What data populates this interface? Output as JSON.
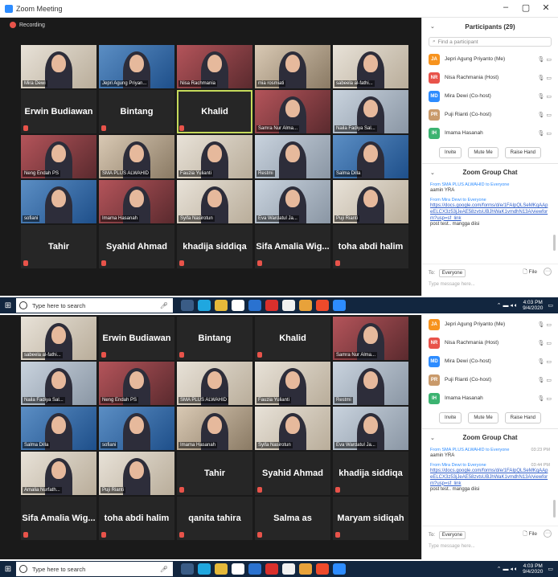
{
  "window": {
    "title": "Zoom Meeting",
    "minimize": "–",
    "maximize": "▢",
    "close": "✕"
  },
  "recording_label": "Recording",
  "participants_panel": {
    "title": "Participants (29)",
    "find_placeholder": "Find a participant",
    "invite": "Invite",
    "mute_me": "Mute Me",
    "raise_hand": "Raise Hand",
    "participants": [
      {
        "initial": "JA",
        "name": "Jepri Agung Priyanto (Me)",
        "color": "#f7931e"
      },
      {
        "initial": "NR",
        "name": "Nisa Rachmania (Host)",
        "color": "#e8534a"
      },
      {
        "initial": "MD",
        "name": "Mira Dewi (Co-host)",
        "color": "#2d8cff"
      },
      {
        "initial": "PR",
        "name": "Puji Rianti (Co-host)",
        "color": "#c99a6b"
      },
      {
        "initial": "IH",
        "name": "Imama Hasanah",
        "color": "#3cb371"
      }
    ]
  },
  "chat": {
    "title": "Zoom Group Chat",
    "msg1_from": "From SMA PLUS ALWAHID to Everyone",
    "msg1_text": "aamin YRA",
    "msg2_from": "From Mira Dewi to Everyone",
    "msg2_link": "https://docs.google.com/forms/d/e/1FAIpQLSeMKqAApeELCX3z53jJeAE58zvtsUBJhWaK1vmdhN13A/viewform?usp=sf_link",
    "msg2_text": "post test.. mangga diisi",
    "to_label": "To:",
    "to_value": "Everyone",
    "file_label": "File",
    "type_placeholder": "Type message here..."
  },
  "chat_bottom": {
    "time1": "03:23 PM",
    "time2": "03:44 PM"
  },
  "taskbar": {
    "search_placeholder": "Type here to search",
    "time": "4:03 PM",
    "date": "9/4/2020"
  },
  "top_tiles": [
    {
      "label": "Mira Dewi",
      "big": "",
      "kind": "cam",
      "bg": "bg4"
    },
    {
      "label": "Jepri Agung Priyan...",
      "big": "",
      "kind": "cam",
      "bg": "bg3"
    },
    {
      "label": "Nisa Rachmania",
      "big": "",
      "kind": "cam",
      "bg": "bg5"
    },
    {
      "label": "mia rosmiati",
      "big": "",
      "kind": "cam",
      "bg": "bg2"
    },
    {
      "label": "sabeela al-fathi...",
      "big": "",
      "kind": "cam",
      "bg": "bg4"
    },
    {
      "label": "",
      "big": "Erwin Budiawan",
      "kind": "name"
    },
    {
      "label": "",
      "big": "Bintang",
      "kind": "name"
    },
    {
      "label": "",
      "big": "Khalid",
      "kind": "name",
      "highlight": true
    },
    {
      "label": "Samra Nur Alma...",
      "big": "",
      "kind": "cam",
      "bg": "bg5"
    },
    {
      "label": "Naila Fadiya Sal...",
      "big": "",
      "kind": "cam",
      "bg": "bg1"
    },
    {
      "label": "Neng Endah PS",
      "big": "",
      "kind": "cam",
      "bg": "bg5"
    },
    {
      "label": "SMA PLUS ALWAHID",
      "big": "",
      "kind": "cam",
      "bg": "bg2"
    },
    {
      "label": "Fauzia Yulianti",
      "big": "",
      "kind": "cam",
      "bg": "bg4"
    },
    {
      "label": "Restmi",
      "big": "",
      "kind": "cam",
      "bg": "bg1"
    },
    {
      "label": "Salma Dilla",
      "big": "",
      "kind": "cam",
      "bg": "bg3"
    },
    {
      "label": "sofiani",
      "big": "",
      "kind": "cam",
      "bg": "bg3"
    },
    {
      "label": "Imama Hasanah",
      "big": "",
      "kind": "cam",
      "bg": "bg5"
    },
    {
      "label": "Syifa Nasirotun",
      "big": "",
      "kind": "cam",
      "bg": "bg4"
    },
    {
      "label": "Eva Wardatul Ja...",
      "big": "",
      "kind": "cam",
      "bg": "bg1"
    },
    {
      "label": "Puji Rianti",
      "big": "",
      "kind": "cam",
      "bg": "bg4"
    },
    {
      "label": "",
      "big": "Tahir",
      "kind": "name"
    },
    {
      "label": "",
      "big": "Syahid Ahmad",
      "kind": "name"
    },
    {
      "label": "",
      "big": "khadija siddiqa",
      "kind": "name"
    },
    {
      "label": "",
      "big": "Sifa Amalia Wig...",
      "kind": "name"
    },
    {
      "label": "",
      "big": "toha abdi halim",
      "kind": "name"
    }
  ],
  "bottom_tiles": [
    {
      "label": "sabeela al-fathi...",
      "big": "",
      "kind": "cam",
      "bg": "bg4"
    },
    {
      "label": "",
      "big": "Erwin Budiawan",
      "kind": "name"
    },
    {
      "label": "",
      "big": "Bintang",
      "kind": "name"
    },
    {
      "label": "",
      "big": "Khalid",
      "kind": "name"
    },
    {
      "label": "Samra Nur Alma...",
      "big": "",
      "kind": "cam",
      "bg": "bg5"
    },
    {
      "label": "Naila Fadiya Sal...",
      "big": "",
      "kind": "cam",
      "bg": "bg1"
    },
    {
      "label": "Neng Endah PS",
      "big": "",
      "kind": "cam",
      "bg": "bg5"
    },
    {
      "label": "SMA PLUS ALWAHID",
      "big": "",
      "kind": "cam",
      "bg": "bg4"
    },
    {
      "label": "Fauzia Yulianti",
      "big": "",
      "kind": "cam",
      "bg": "bg4"
    },
    {
      "label": "Restmi",
      "big": "",
      "kind": "cam",
      "bg": "bg1"
    },
    {
      "label": "Salma Dilla",
      "big": "",
      "kind": "cam",
      "bg": "bg3"
    },
    {
      "label": "sofiani",
      "big": "",
      "kind": "cam",
      "bg": "bg3"
    },
    {
      "label": "Imama Hasanah",
      "big": "",
      "kind": "cam",
      "bg": "bg2"
    },
    {
      "label": "Syifa Nasirotun",
      "big": "",
      "kind": "cam",
      "bg": "bg4"
    },
    {
      "label": "Eva Wardatul Ja...",
      "big": "",
      "kind": "cam",
      "bg": "bg1"
    },
    {
      "label": "Amalia Nurfath...",
      "big": "",
      "kind": "cam",
      "bg": "bg4"
    },
    {
      "label": "Puji Rianti",
      "big": "",
      "kind": "cam",
      "bg": "bg4"
    },
    {
      "label": "",
      "big": "Tahir",
      "kind": "name"
    },
    {
      "label": "",
      "big": "Syahid Ahmad",
      "kind": "name"
    },
    {
      "label": "",
      "big": "khadija siddiqa",
      "kind": "name"
    },
    {
      "label": "",
      "big": "Sifa Amalia Wig...",
      "kind": "name"
    },
    {
      "label": "",
      "big": "toha abdi halim",
      "kind": "name"
    },
    {
      "label": "",
      "big": "qanita tahira",
      "kind": "name"
    },
    {
      "label": "",
      "big": "Salma as",
      "kind": "name"
    },
    {
      "label": "",
      "big": "Maryam sidiqah",
      "kind": "name"
    }
  ]
}
